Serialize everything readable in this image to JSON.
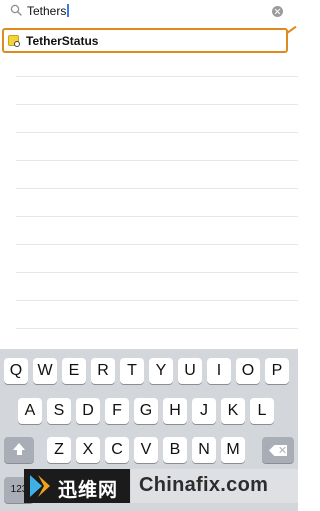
{
  "search": {
    "query": "Tethers"
  },
  "results": [
    {
      "label": "TetherStatus",
      "icon": "tether-app-icon"
    }
  ],
  "keyboard": {
    "row1": [
      "Q",
      "W",
      "E",
      "R",
      "T",
      "Y",
      "U",
      "I",
      "O",
      "P"
    ],
    "row2": [
      "A",
      "S",
      "D",
      "F",
      "G",
      "H",
      "J",
      "K",
      "L"
    ],
    "row3": [
      "Z",
      "X",
      "C",
      "V",
      "B",
      "N",
      "M"
    ],
    "numbers_label": "123",
    "shift_icon": "shift-icon",
    "delete_icon": "delete-icon"
  },
  "watermark": {
    "cn_text": "迅维网",
    "en_text": "Chinafix.com"
  },
  "colors": {
    "highlight": "#e08a1e",
    "keyboard_bg": "#d3d6db",
    "key_bg": "#ffffff",
    "function_key_bg": "#a9aeb6"
  }
}
